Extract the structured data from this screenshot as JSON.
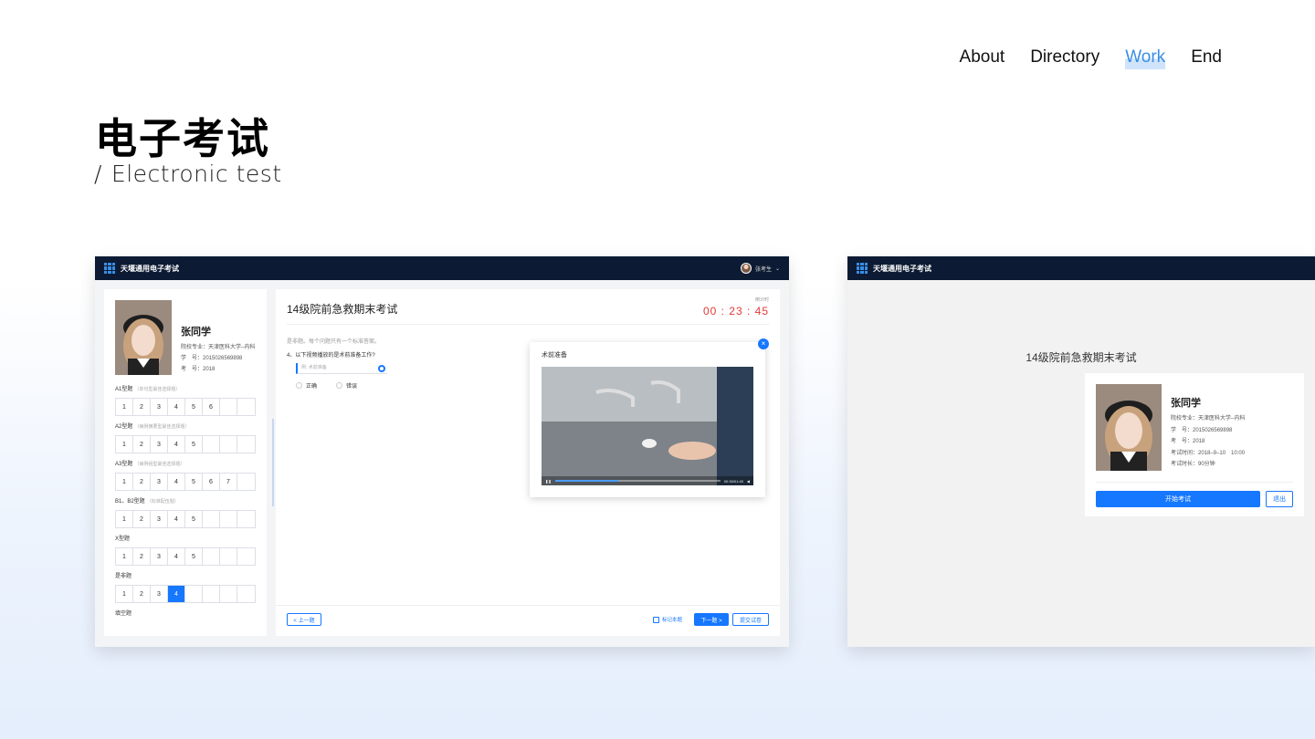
{
  "nav": {
    "items": [
      {
        "label": "About"
      },
      {
        "label": "Directory"
      },
      {
        "label": "Work"
      },
      {
        "label": "End"
      }
    ],
    "active": "Work"
  },
  "hero": {
    "title": "电子考试",
    "slash": "/",
    "subtitle": "Electronic test"
  },
  "colors": {
    "accent": "#1677ff",
    "appbar": "#0c1b33",
    "timer": "#e53935",
    "nav_active": "#3a8ee6"
  },
  "exam_screen": {
    "app_name": "天堰通用电子考试",
    "user_name": "张考生",
    "user_icon": "chevron-down-icon",
    "student": {
      "name": "张同学",
      "info": [
        "院校专业：天津医科大学–内科",
        "学　号：2015026569898",
        "考　号：2018"
      ]
    },
    "sections": [
      {
        "title": "A1型题",
        "hint": "（单句型最佳选择题）",
        "cells": [
          "1",
          "2",
          "3",
          "4",
          "5",
          "6",
          "",
          ""
        ]
      },
      {
        "title": "A2型题",
        "hint": "（病例摘要型最佳选择题）",
        "cells": [
          "1",
          "2",
          "3",
          "4",
          "5",
          "",
          "",
          ""
        ]
      },
      {
        "title": "A3型题",
        "hint": "（病例组型最佳选择题）",
        "cells": [
          "1",
          "2",
          "3",
          "4",
          "5",
          "6",
          "7",
          ""
        ]
      },
      {
        "title": "B1、B2型题",
        "hint": "（标准配伍题）",
        "cells": [
          "1",
          "2",
          "3",
          "4",
          "5",
          "",
          "",
          ""
        ]
      },
      {
        "title": "X型题",
        "hint": "",
        "cells": [
          "1",
          "2",
          "3",
          "4",
          "5",
          "",
          "",
          ""
        ]
      },
      {
        "title": "是非题",
        "hint": "",
        "cells": [
          "1",
          "2",
          "3",
          "4",
          "",
          "",
          "",
          ""
        ]
      },
      {
        "title": "填空题",
        "hint": "",
        "cells": []
      }
    ],
    "selected_cell": {
      "section": 5,
      "index": 3
    },
    "exam_title": "14级院前急救期末考试",
    "timer_label": "倒计时",
    "timer": "00 : 23 : 45",
    "tip": "是非题。每个问题只有一个标准答案。",
    "question": "4、以下视频播放的是术前准备工作?",
    "answer_placeholder": "例: 术前准备",
    "options": [
      "正确",
      "错误"
    ],
    "video": {
      "title": "术前准备",
      "time": "00:30/01:40",
      "progress": 0.38
    },
    "prev_label": "< 上一题",
    "mark_label": "标记本题",
    "next_label": "下一题 >",
    "submit_label": "提交试卷"
  },
  "login_screen": {
    "app_name": "天堰通用电子考试",
    "exam_title": "14级院前急救期末考试",
    "student": {
      "name": "张同学",
      "info": [
        "院校专业：天津医科大学–内科",
        "学　号：2015026569898",
        "考　号：2018",
        "考试时间：2018–9–10　10:00",
        "考试时长：90分钟"
      ]
    },
    "start_label": "开始考试",
    "exit_label": "退出"
  }
}
